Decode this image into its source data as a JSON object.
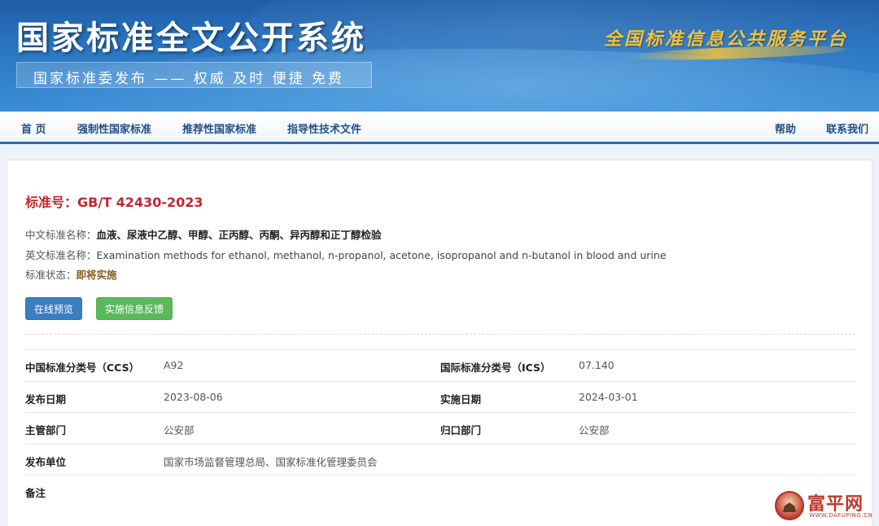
{
  "header": {
    "site_title": "国家标准全文公开系统",
    "subtitle": "国家标准委发布 —— 权威 及时 便捷 免费",
    "slogan": "全国标准信息公共服务平台"
  },
  "nav": {
    "left": [
      "首 页",
      "强制性国家标准",
      "推荐性国家标准",
      "指导性技术文件"
    ],
    "right": [
      "帮助",
      "联系我们"
    ]
  },
  "standard": {
    "number_label": "标准号：",
    "number": "GB/T 42430-2023",
    "cn_name_label": "中文标准名称：",
    "cn_name": "血液、尿液中乙醇、甲醇、正丙醇、丙酮、异丙醇和正丁醇检验",
    "en_name_label": "英文标准名称：",
    "en_name": "Examination methods for ethanol, methanol, n-propanol, acetone, isopropanol and n-butanol in blood and urine",
    "status_label": "标准状态：",
    "status": "即将实施"
  },
  "buttons": {
    "preview": "在线预览",
    "feedback": "实施信息反馈"
  },
  "details": {
    "ccs_label": "中国标准分类号（CCS）",
    "ccs": "A92",
    "ics_label": "国际标准分类号（ICS）",
    "ics": "07.140",
    "publish_date_label": "发布日期",
    "publish_date": "2023-08-06",
    "implement_date_label": "实施日期",
    "implement_date": "2024-03-01",
    "authority_label": "主管部门",
    "authority": "公安部",
    "centralized_label": "归口部门",
    "centralized": "公安部",
    "publisher_label": "发布单位",
    "publisher": "国家市场监督管理总局、国家标准化管理委员会",
    "remarks_label": "备注",
    "remarks": ""
  },
  "watermark": {
    "text": "富平网",
    "url": "WWW.DAFUPING.CN"
  },
  "colors": {
    "banner": "#2a76c2",
    "nav_text": "#1f4f8c",
    "std_number": "#c0282d",
    "btn_blue": "#3c7ec2",
    "btn_green": "#5cb85c"
  }
}
